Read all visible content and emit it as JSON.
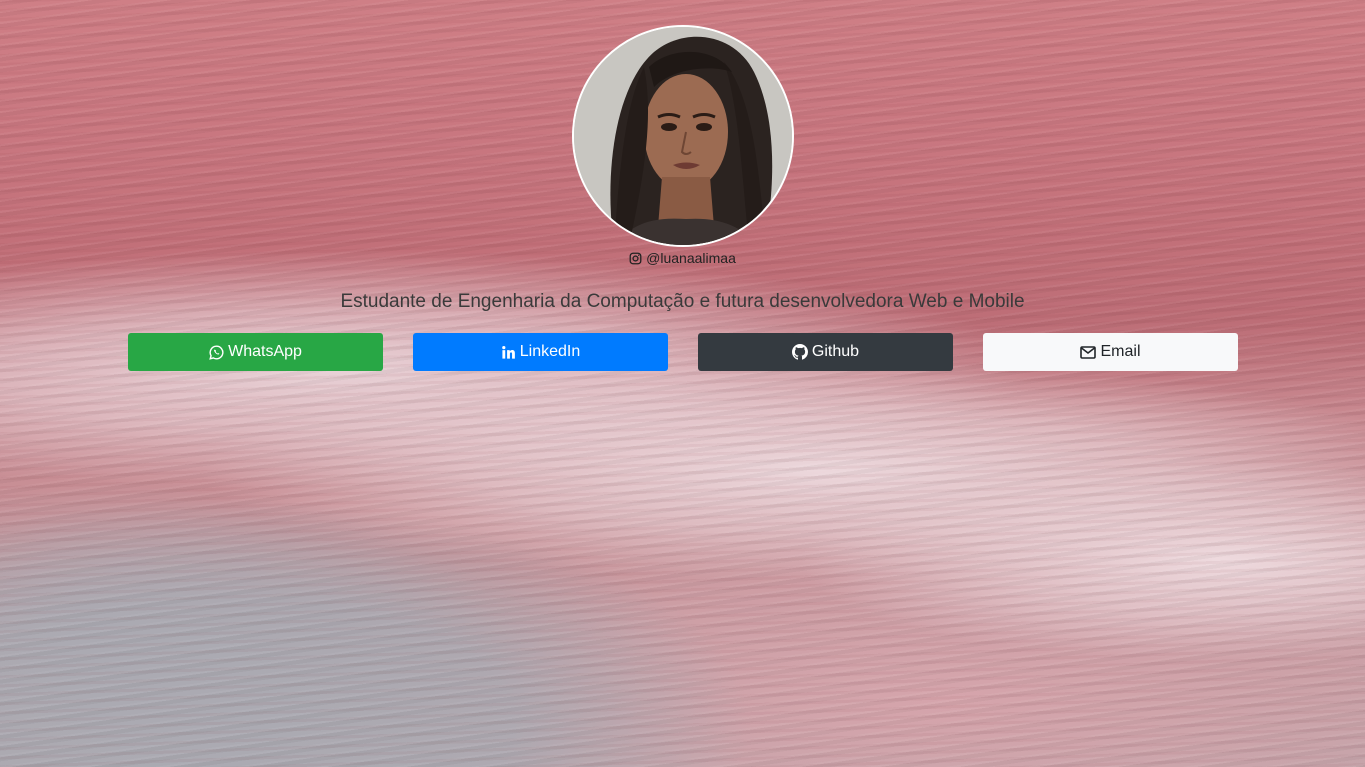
{
  "profile": {
    "handle": "@luanaalimaa",
    "bio": "Estudante de Engenharia da Computação e futura desenvolvedora Web e Mobile"
  },
  "buttons": {
    "whatsapp": {
      "label": "WhatsApp",
      "icon": "whatsapp-icon",
      "color": "#28a745"
    },
    "linkedin": {
      "label": "LinkedIn",
      "icon": "linkedin-icon",
      "color": "#007bff"
    },
    "github": {
      "label": "Github",
      "icon": "github-icon",
      "color": "#343a40"
    },
    "email": {
      "label": "Email",
      "icon": "envelope-icon",
      "color": "#f8f9fa"
    }
  }
}
